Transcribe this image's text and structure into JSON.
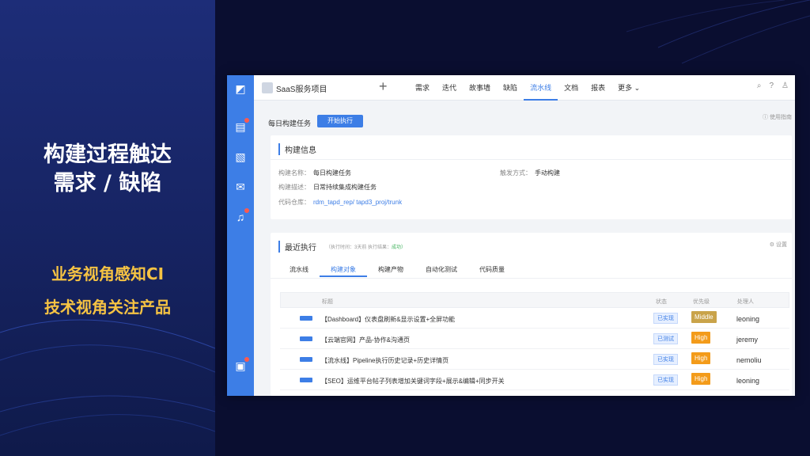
{
  "slide": {
    "headline_line1": "构建过程触达",
    "headline_line2": "需求 / 缺陷",
    "sub1": "业务视角感知CI",
    "sub2": "技术视角关注产品"
  },
  "app": {
    "project_name": "SaaS服务项目",
    "nav": [
      "需求",
      "迭代",
      "故事墙",
      "缺陷",
      "流水线",
      "文档",
      "报表",
      "更多"
    ],
    "nav_active": "流水线",
    "task_label": "每日构建任务",
    "start_button": "开始执行",
    "help_link": "使用指南",
    "build_info": {
      "title": "构建信息",
      "name_label": "构建名称：",
      "name_value": "每日构建任务",
      "desc_label": "构建描述：",
      "desc_value": "日常持续集成构建任务",
      "repo_label": "代码仓库：",
      "repo_value": "rdm_tapd_rep/ tapd3_proj/trunk",
      "trigger_label": "触发方式：",
      "trigger_value": "手动构建"
    },
    "recent": {
      "title": "最近执行",
      "filter_time": "（执行时间：3天前",
      "filter_result_label": "执行结果：",
      "filter_result_value": "成功）",
      "settings": "设置",
      "tabs": [
        "流水线",
        "构建对象",
        "构建产物",
        "自动化测试",
        "代码质量"
      ],
      "active_tab": "构建对象",
      "columns": [
        "标题",
        "状态",
        "优先级",
        "处理人"
      ],
      "rows": [
        {
          "title": "【Dashboard】仪表盘刷新&显示设置+全屏功能",
          "status": "已实现",
          "priority": "Middle",
          "priority_color": "#c9a34a",
          "owner": "leoning"
        },
        {
          "title": "【云端官网】产品-协作&沟通页",
          "status": "已测试",
          "priority": "High",
          "priority_color": "#f39b1a",
          "owner": "jeremy"
        },
        {
          "title": "【流水线】Pipeline执行历史记录+历史详情页",
          "status": "已实现",
          "priority": "High",
          "priority_color": "#f39b1a",
          "owner": "nemoliu"
        },
        {
          "title": "【SEO】运维平台帖子列表增加关键词字段+展示&编辑+同步开关",
          "status": "已实现",
          "priority": "High",
          "priority_color": "#f39b1a",
          "owner": "leoning"
        }
      ]
    }
  },
  "colors": {
    "accent": "#3d7ee6",
    "slide_bg": "#162361",
    "headline_yellow": "#f6c343"
  }
}
